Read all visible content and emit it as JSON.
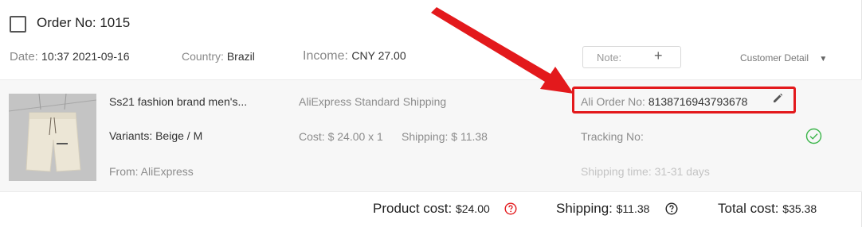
{
  "order": {
    "title": "Order No: 1015",
    "date_label": "Date:",
    "date_value": "10:37 2021-09-16",
    "country_label": "Country:",
    "country_value": "Brazil",
    "income_label": "Income:",
    "income_value": "CNY 27.00",
    "note_label": "Note:",
    "note_add": "+",
    "customer_detail": "Customer Detail",
    "customer_detail_caret": "▼"
  },
  "item": {
    "name": "Ss21 fashion brand men's...",
    "variants": "Variants: Beige / M",
    "from": "From: AliExpress",
    "shipping_method": "AliExpress Standard Shipping",
    "cost": "Cost: $ 24.00 x 1",
    "shipping": "Shipping: $ 11.38",
    "ali_order_label": "Ali Order No:",
    "ali_order_value": "8138716943793678",
    "tracking_label": "Tracking No:",
    "shipping_time": "Shipping time: 31-31 days"
  },
  "footer": {
    "product_cost_label": "Product cost:",
    "product_cost_value": "$24.00",
    "shipping_label": "Shipping:",
    "shipping_value": "$11.38",
    "total_cost_label": "Total cost:",
    "total_cost_value": "$35.38"
  },
  "icons": {
    "edit": "pencil-icon",
    "check": "check-circle-icon",
    "help_red": "question-circle-icon",
    "help_dark": "question-circle-icon"
  },
  "colors": {
    "annotation_red": "#e3191c",
    "success_green": "#3bb54a",
    "item_bg": "#f7f7f7"
  }
}
